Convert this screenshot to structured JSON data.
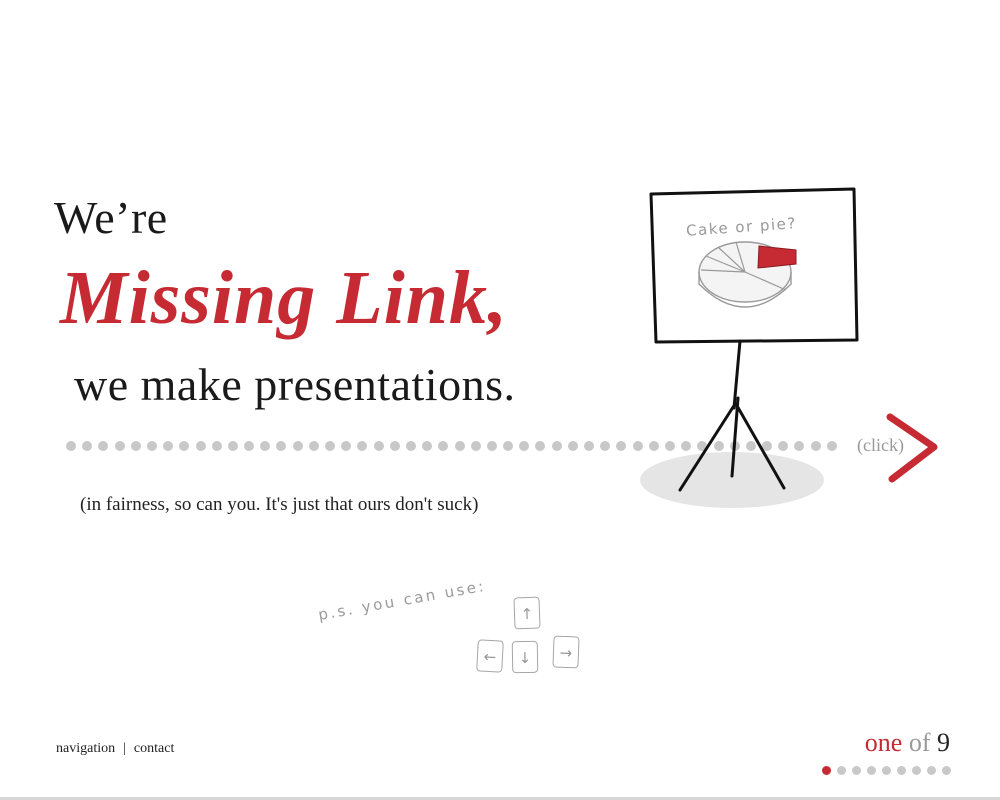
{
  "hero": {
    "line1": "We’re",
    "brand": "Missing Link,",
    "line3": "we make presentations.",
    "tagline": "(in fairness, so can you. It's just that ours don't suck)",
    "click_hint": "(click)"
  },
  "illustration": {
    "board_title": "Cake or pie?",
    "ps_note": "p.s. you can use:",
    "keys": {
      "up": "↑",
      "left": "←",
      "down": "↓",
      "right": "→"
    }
  },
  "footer": {
    "nav_link": "navigation",
    "separator": "|",
    "contact_link": "contact"
  },
  "pager": {
    "current_word": "one",
    "of_word": "of",
    "total": "9",
    "current_index": 1,
    "total_pages": 9
  },
  "colors": {
    "accent": "#c62a32",
    "dot": "#c8c8c8",
    "muted_text": "#999999"
  }
}
